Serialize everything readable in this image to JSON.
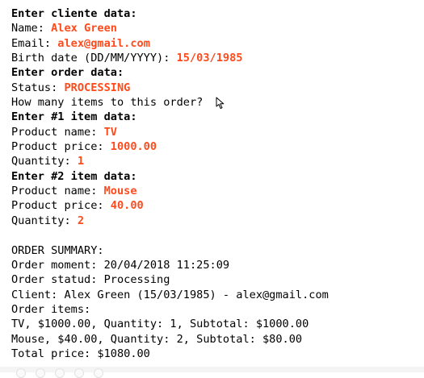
{
  "console": {
    "client_header": "Enter cliente data:",
    "name_prompt": "Name: ",
    "name_value": "Alex Green",
    "email_prompt": "Email: ",
    "email_value": "alex@gmail.com",
    "birth_prompt": "Birth date (DD/MM/YYYY): ",
    "birth_value": "15/03/1985",
    "order_header": "Enter order data:",
    "status_prompt": "Status: ",
    "status_value": "PROCESSING",
    "items_prompt": "How many items to this order? ",
    "item1_header": "Enter #1 item data:",
    "item1_name_prompt": "Product name: ",
    "item1_name_value": "TV",
    "item1_price_prompt": "Product price: ",
    "item1_price_value": "1000.00",
    "item1_qty_prompt": "Quantity: ",
    "item1_qty_value": "1",
    "item2_header": "Enter #2 item data:",
    "item2_name_prompt": "Product name: ",
    "item2_name_value": "Mouse",
    "item2_price_prompt": "Product price: ",
    "item2_price_value": "40.00",
    "item2_qty_prompt": "Quantity: ",
    "item2_qty_value": "2",
    "summary_header": "ORDER SUMMARY:",
    "order_moment": "Order moment: 20/04/2018 11:25:09",
    "order_status": "Order statud: Processing",
    "client": "Client: Alex Green (15/03/1985) - alex@gmail.com",
    "order_items_label": "Order items:",
    "item_line_1": "TV, $1000.00, Quantity: 1, Subtotal: $1000.00",
    "item_line_2": "Mouse, $40.00, Quantity: 2, Subtotal: $80.00",
    "total_price": "Total price: $1080.00"
  },
  "icons": {
    "cursor": "mouse-pointer-icon"
  },
  "colors": {
    "input_text": "#ff4a1c",
    "output_text": "#000000",
    "background": "#ffffff"
  }
}
